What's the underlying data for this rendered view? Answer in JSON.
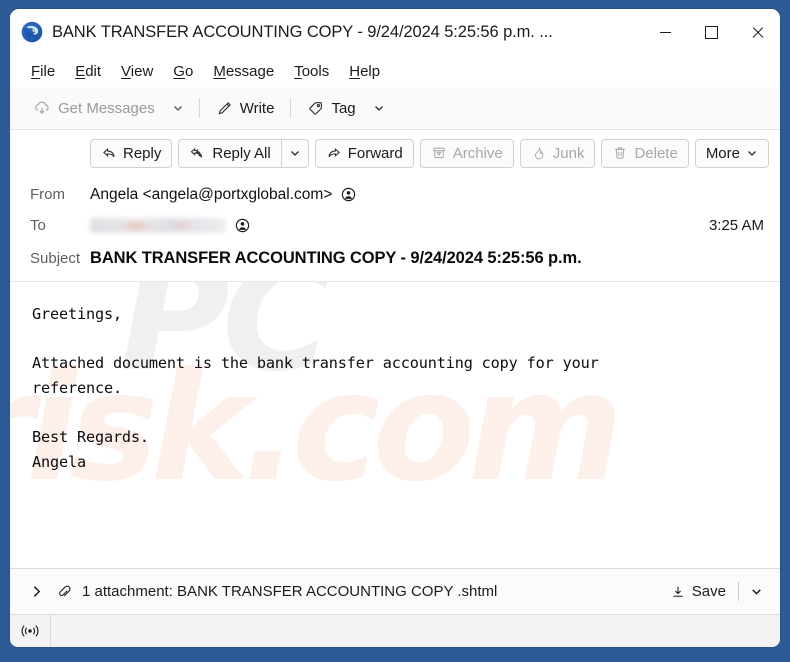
{
  "window": {
    "title": "BANK TRANSFER ACCOUNTING COPY - 9/24/2024 5:25:56 p.m. ...",
    "app_icon": "thunderbird-logo",
    "controls": {
      "minimize": "minimize-icon",
      "maximize": "maximize-icon",
      "close": "close-icon"
    },
    "frame_color": "#2d5b96"
  },
  "menubar": {
    "items": [
      {
        "label": "File",
        "accel": "F"
      },
      {
        "label": "Edit",
        "accel": "E"
      },
      {
        "label": "View",
        "accel": "V"
      },
      {
        "label": "Go",
        "accel": "G"
      },
      {
        "label": "Message",
        "accel": "M"
      },
      {
        "label": "Tools",
        "accel": "T"
      },
      {
        "label": "Help",
        "accel": "H"
      }
    ]
  },
  "main_toolbar": {
    "get_messages": {
      "label": "Get Messages",
      "icon": "cloud-download-icon",
      "disabled": true
    },
    "get_messages_caret": "chevron-down-icon",
    "write": {
      "label": "Write",
      "icon": "pencil-icon",
      "disabled": false
    },
    "tag": {
      "label": "Tag",
      "icon": "tag-icon",
      "disabled": false
    },
    "tag_caret": "chevron-down-icon"
  },
  "message_toolbar": {
    "reply": {
      "label": "Reply",
      "icon": "reply-icon",
      "disabled": false
    },
    "reply_all": {
      "label": "Reply All",
      "icon": "reply-all-icon",
      "disabled": false
    },
    "reply_all_caret": "chevron-down-icon",
    "forward": {
      "label": "Forward",
      "icon": "forward-icon",
      "disabled": false
    },
    "archive": {
      "label": "Archive",
      "icon": "archive-icon",
      "disabled": true
    },
    "junk": {
      "label": "Junk",
      "icon": "flame-icon",
      "disabled": true
    },
    "delete": {
      "label": "Delete",
      "icon": "trash-icon",
      "disabled": true
    },
    "more": {
      "label": "More",
      "icon": "chevron-down-icon",
      "disabled": false
    }
  },
  "headers": {
    "from_label": "From",
    "from_value": "Angela <angela@portxglobal.com>",
    "from_avatar": "contact-icon",
    "to_label": "To",
    "to_value": "",
    "to_redacted": true,
    "to_avatar": "contact-icon",
    "time": "3:25 AM",
    "subject_label": "Subject",
    "subject_value": "BANK TRANSFER ACCOUNTING COPY - 9/24/2024 5:25:56 p.m."
  },
  "body": {
    "text": "Greetings,\n\nAttached document is the bank transfer accounting copy for your\nreference.\n\nBest Regards.\nAngela",
    "watermark": "PCrisk.com"
  },
  "attachment": {
    "expand_icon": "chevron-right-icon",
    "clip_icon": "paperclip-icon",
    "summary": "1 attachment: BANK TRANSFER ACCOUNTING COPY .shtml",
    "save_label": "Save",
    "save_icon": "download-icon",
    "save_caret": "chevron-down-icon"
  },
  "statusbar": {
    "connection_icon": "online-broadcast-icon",
    "text": ""
  }
}
